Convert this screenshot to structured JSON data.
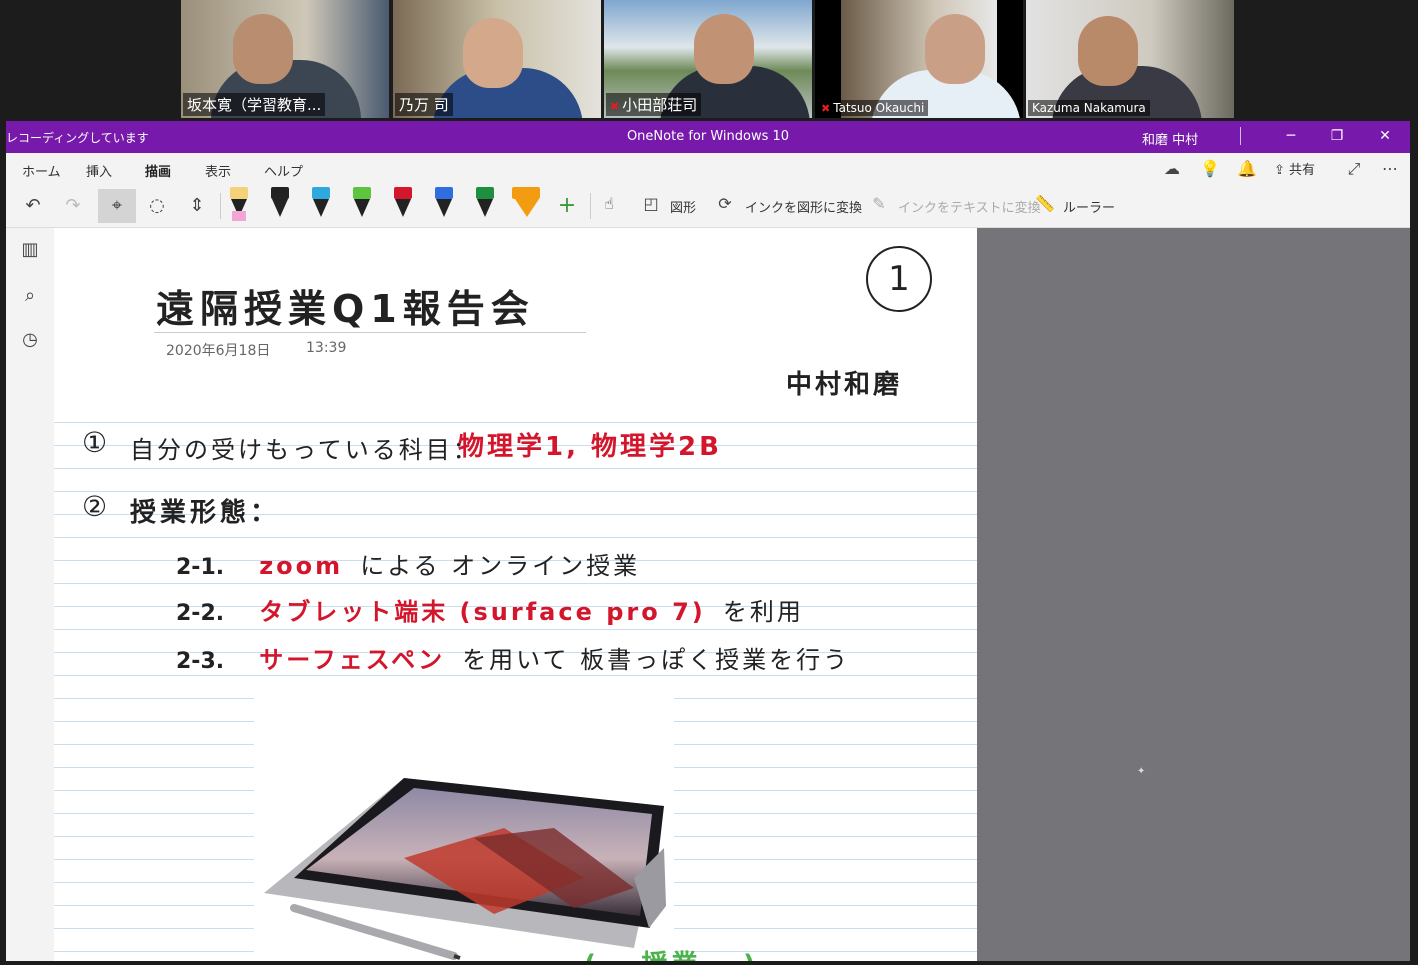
{
  "participants": [
    {
      "name": "坂本寛（学習教育...",
      "muted": false,
      "active": true
    },
    {
      "name": "乃万 司",
      "muted": false,
      "active": false
    },
    {
      "name": "小田部荘司",
      "muted": true,
      "active": false
    },
    {
      "name": "Tatsuo Okauchi",
      "muted": true,
      "active": false
    },
    {
      "name": "Kazuma Nakamura",
      "muted": false,
      "active": false
    }
  ],
  "window": {
    "recording_status": "レコーディングしています",
    "title": "OneNote for Windows 10",
    "user": "和磨 中村",
    "controls": {
      "minimize": "─",
      "restore": "❐",
      "close": "✕"
    }
  },
  "menu": {
    "items": [
      "ホーム",
      "挿入",
      "描画",
      "表示",
      "ヘルプ"
    ],
    "selected": "描画",
    "share_label": "共有"
  },
  "toolbar": {
    "pen_colors": [
      "#f3a5d6",
      "#222222",
      "#2fa8e0",
      "#5cc43d",
      "#d3162b",
      "#2f6ee0",
      "#1e8f3e",
      "#f39c12"
    ],
    "shapes_label": "図形",
    "ink_to_shape_label": "インクを図形に変換",
    "ink_to_text_label": "インクをテキストに変換",
    "ruler_label": "ルーラー"
  },
  "page": {
    "title": "遠隔授業Q1報告会",
    "date": "2020年6月18日",
    "time": "13:39",
    "page_number_mark": "1",
    "author": "中村和磨",
    "item1": {
      "num": "①",
      "label": "自分の受けもっている科目：",
      "value": "物理学1, 物理学2B"
    },
    "item2": {
      "num": "②",
      "label": "授業形態：",
      "subitems": [
        {
          "num": "2-1.",
          "red": "zoom",
          "black": "による オンライン授業"
        },
        {
          "num": "2-2.",
          "red": "タブレット端末 (surface pro 7)",
          "black": "を利用"
        },
        {
          "num": "2-3.",
          "red": "サーフェスペン",
          "black": "を用いて 板書っぽく授業を行う"
        }
      ]
    },
    "bottom_partial": "(...授業...)"
  }
}
